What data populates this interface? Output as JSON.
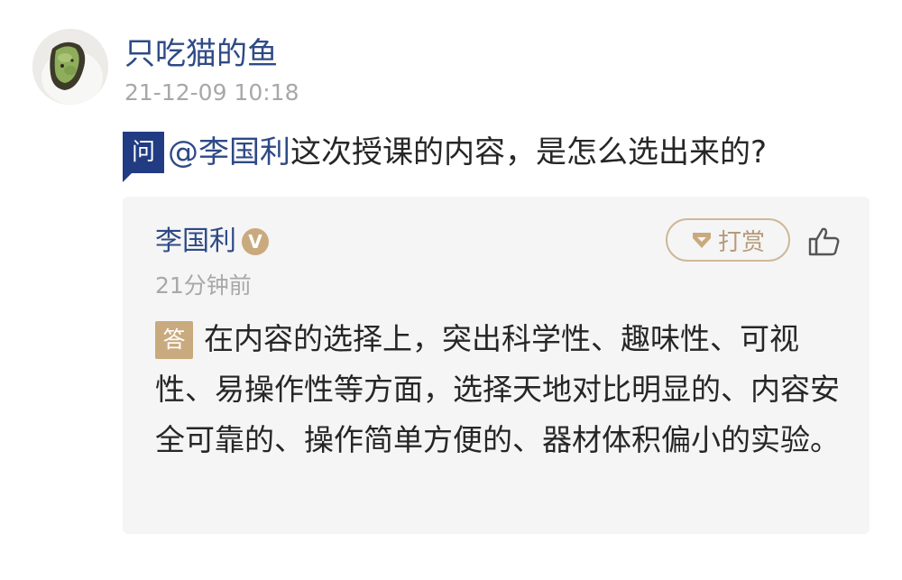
{
  "post": {
    "author": "只吃猫的鱼",
    "timestamp": "21-12-09 10:18",
    "question_badge": "问",
    "question_mention": "@李国利",
    "question_text": "这次授课的内容，是怎么选出来的?"
  },
  "answer": {
    "author": "李国利",
    "verified_badge": "V",
    "tip_label": "打赏",
    "time": "21分钟前",
    "answer_badge": "答",
    "text": "在内容的选择上，突出科学性、趣味性、可视性、易操作性等方面，选择天地对比明显的、内容安全可靠的、操作简单方便的、器材体积偏小的实验。"
  },
  "colors": {
    "link_blue": "#2e4a86",
    "question_badge_bg": "#213c82",
    "gold_accent": "#c9aa7e",
    "card_bg": "#f5f5f5",
    "muted_text": "#a8a8a8"
  },
  "icons": {
    "avatar": "avatar-food-photo",
    "verified": "verified-v-icon",
    "tip": "gem-icon",
    "like": "thumbs-up-icon"
  }
}
